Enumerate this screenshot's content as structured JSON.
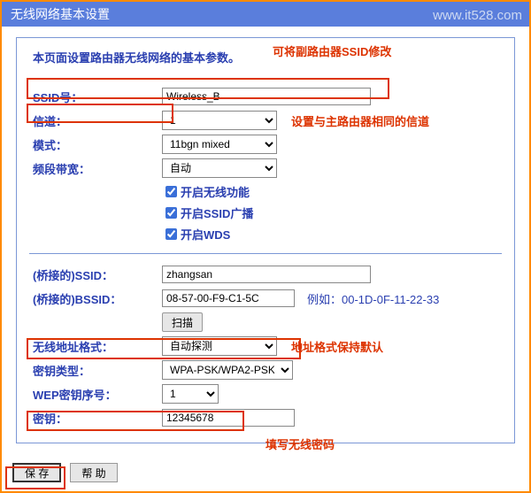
{
  "title": "无线网络基本设置",
  "watermark": "www.it528.com",
  "intro": "本页面设置路由器无线网络的基本参数。",
  "annotations": {
    "ssid_hint": "可将副路由器SSID修改",
    "channel_hint": "设置与主路由器相同的信道",
    "bssid_example": "例如：00-1D-0F-11-22-33",
    "addr_hint": "地址格式保持默认",
    "pwd_hint": "填写无线密码"
  },
  "fields": {
    "ssid": {
      "label": "SSID号：",
      "value": "Wireless_B"
    },
    "channel": {
      "label": "信道：",
      "value": "1"
    },
    "mode": {
      "label": "模式：",
      "value": "11bgn mixed"
    },
    "bandwidth": {
      "label": "频段带宽：",
      "value": "自动"
    },
    "enable_wifi": {
      "label": "开启无线功能",
      "checked": true
    },
    "enable_ssid": {
      "label": "开启SSID广播",
      "checked": true
    },
    "enable_wds": {
      "label": "开启WDS",
      "checked": true
    },
    "br_ssid": {
      "label": "(桥接的)SSID：",
      "value": "zhangsan"
    },
    "br_bssid": {
      "label": "(桥接的)BSSID：",
      "value": "08-57-00-F9-C1-5C"
    },
    "scan": {
      "label": "扫描"
    },
    "addr_fmt": {
      "label": "无线地址格式：",
      "value": "自动探测"
    },
    "sec_type": {
      "label": "密钥类型：",
      "value": "WPA-PSK/WPA2-PSK"
    },
    "wep_idx": {
      "label": "WEP密钥序号：",
      "value": "1"
    },
    "key": {
      "label": "密钥：",
      "value": "12345678"
    }
  },
  "footer": {
    "save": "保 存",
    "help": "帮 助"
  }
}
